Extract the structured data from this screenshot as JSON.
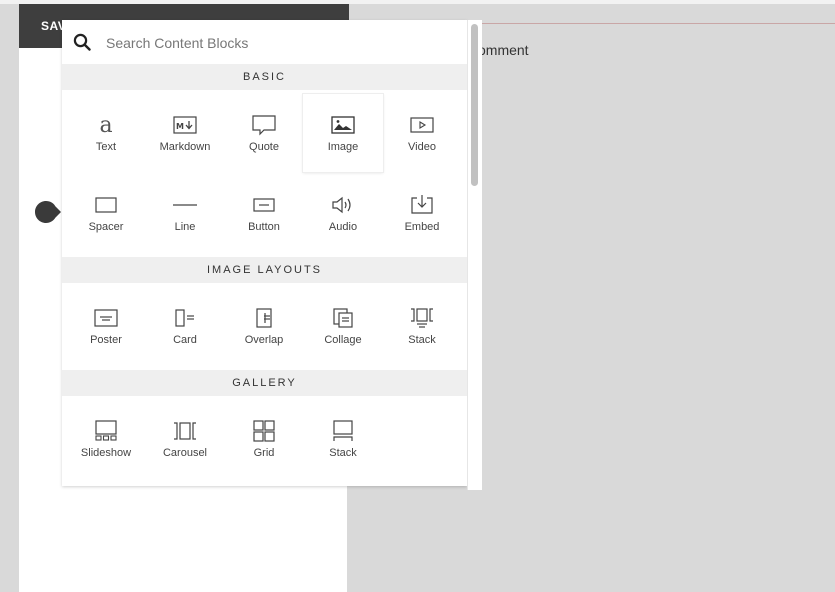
{
  "toolbar": {
    "save_label": "SAV"
  },
  "page": {
    "comment_label": "omment"
  },
  "menu": {
    "search": {
      "placeholder": "Search Content Blocks",
      "value": ""
    },
    "sections": {
      "basic": {
        "title": "BASIC",
        "items": [
          {
            "label": "Text",
            "icon": "text-icon"
          },
          {
            "label": "Markdown",
            "icon": "markdown-icon"
          },
          {
            "label": "Quote",
            "icon": "quote-icon"
          },
          {
            "label": "Image",
            "icon": "image-icon"
          },
          {
            "label": "Video",
            "icon": "video-icon"
          },
          {
            "label": "Spacer",
            "icon": "spacer-icon"
          },
          {
            "label": "Line",
            "icon": "line-icon"
          },
          {
            "label": "Button",
            "icon": "button-icon"
          },
          {
            "label": "Audio",
            "icon": "audio-icon"
          },
          {
            "label": "Embed",
            "icon": "embed-icon"
          }
        ]
      },
      "image_layouts": {
        "title": "IMAGE LAYOUTS",
        "items": [
          {
            "label": "Poster",
            "icon": "poster-icon"
          },
          {
            "label": "Card",
            "icon": "card-icon"
          },
          {
            "label": "Overlap",
            "icon": "overlap-icon"
          },
          {
            "label": "Collage",
            "icon": "collage-icon"
          },
          {
            "label": "Stack",
            "icon": "stack-icon"
          }
        ]
      },
      "gallery": {
        "title": "GALLERY",
        "items": [
          {
            "label": "Slideshow",
            "icon": "slideshow-icon"
          },
          {
            "label": "Carousel",
            "icon": "carousel-icon"
          },
          {
            "label": "Grid",
            "icon": "grid-icon"
          },
          {
            "label": "Stack",
            "icon": "gallery-stack-icon"
          }
        ]
      }
    }
  },
  "colors": {
    "toolbar_bg": "#3e3e3e",
    "backdrop": "#d9d9d9",
    "section_bg": "#efefef"
  }
}
